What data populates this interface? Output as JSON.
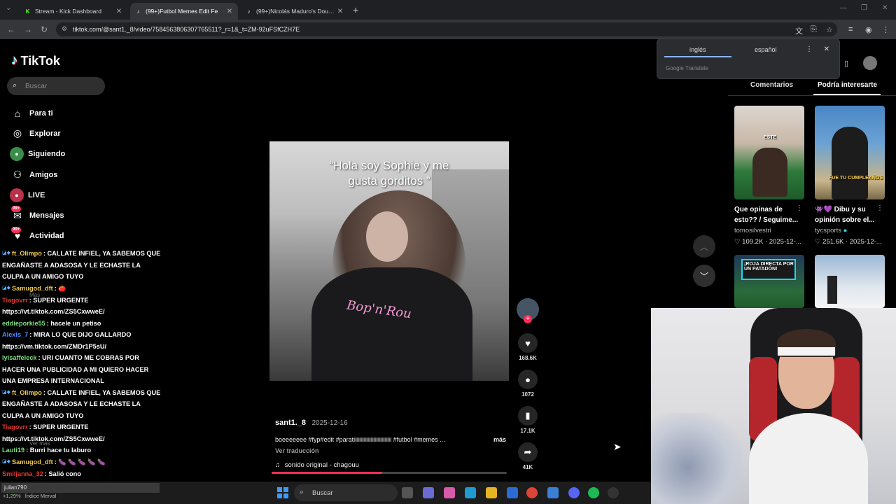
{
  "browser": {
    "tabs": [
      {
        "title": "Stream - Kick Dashboard",
        "favicon": "K",
        "color": "#53fc18",
        "active": false
      },
      {
        "title": "(99+)Futbol Memes Edit Fe",
        "favicon": "♪",
        "color": "#ffffff",
        "active": true
      },
      {
        "title": "(99+)Nicolás Maduro's Doubts",
        "favicon": "♪",
        "color": "#ffffff",
        "active": false
      }
    ],
    "url": "tiktok.com/@sant1._8/video/7584563806307765511?_r=1&_t=ZM-92uFSfCZH7E"
  },
  "translate_popup": {
    "source_lang": "inglés",
    "target_lang": "español",
    "provider": "Google Translate"
  },
  "sidebar": {
    "logo": "TikTok",
    "search_placeholder": "Buscar",
    "items": [
      {
        "label": "Para ti",
        "icon": "home-icon",
        "glyph": "⌂"
      },
      {
        "label": "Explorar",
        "icon": "compass-icon",
        "glyph": "◎"
      },
      {
        "label": "Siguiendo",
        "icon": "following-avatar-icon",
        "glyph": "●"
      },
      {
        "label": "Amigos",
        "icon": "friends-icon",
        "glyph": "⚇"
      },
      {
        "label": "LIVE",
        "icon": "live-icon",
        "glyph": "●"
      },
      {
        "label": "Mensajes",
        "icon": "messages-icon",
        "glyph": "✉",
        "badge": "99+"
      },
      {
        "label": "Actividad",
        "icon": "activity-icon",
        "glyph": "♥",
        "badge": "99+"
      }
    ]
  },
  "chat": [
    {
      "user": "ft_Olimpo",
      "color": "#f2c94c",
      "badges": "◪◆",
      "text": ": CALLATE INFIEL, YA SABEMOS QUE ENGAÑASTE A ADASOSA Y LE ECHASTE LA CULPA A UN AMIGO TUYO"
    },
    {
      "user": "Samugod_dft",
      "color": "#f2c94c",
      "badges": "◪◆",
      "text": ": 🍅"
    },
    {
      "user": "Tiagovrr",
      "color": "#e53935",
      "badges": "",
      "text": ": SUPER URGENTE https://vt.tiktok.com/ZS5CxwweE/"
    },
    {
      "user": "eddieporkie55",
      "color": "#7ee081",
      "badges": "",
      "text": ": hacele un petiso"
    },
    {
      "user": "Alexis_7",
      "color": "#4a8cff",
      "badges": "",
      "text": ": MIRA LO QUE DIJO GALLARDO https://vm.tiktok.com/ZMDr1P5sU/"
    },
    {
      "user": "lyisaffeleck",
      "color": "#7ee081",
      "badges": "",
      "text": ": URI CUANTO ME COBRAS POR HACER UNA PUBLICIDAD A MI QUIERO HACER UNA EMPRESA INTERNACIONAL"
    },
    {
      "user": "ft_Olimpo",
      "color": "#f2c94c",
      "badges": "◪◆",
      "text": ": CALLATE INFIEL, YA SABEMOS QUE ENGAÑASTE A ADASOSA Y LE ECHASTE LA CULPA A UN AMIGO TUYO"
    },
    {
      "user": "Tiagovrr",
      "color": "#e53935",
      "badges": "",
      "text": ": SUPER URGENTE https://vt.tiktok.com/ZS5CxwweE/"
    },
    {
      "user": "Lauti19",
      "color": "#7ee081",
      "badges": "",
      "text": ": Burri hace tu laburo"
    },
    {
      "user": "Samugod_dft",
      "color": "#f2c94c",
      "badges": "◪◆",
      "text": ": 🍆 🍆 🍆 🍆 🍆"
    },
    {
      "user": "Smiljanna_32",
      "color": "#e53935",
      "badges": "",
      "text": ": Salió cono"
    }
  ],
  "video": {
    "caption_line1": "“Hola soy Sophie y me",
    "caption_line2": "gusta gorditos ”",
    "jersey_text": "Bop'n'Rou",
    "author": "sant1._8",
    "date": "2025-12-16",
    "description": "boeeeeeee #fyp#edit #paratiiiiiiiiiiiiiiiiiiiiiiiiiii #futbol #memes ...",
    "more_label": "más",
    "translate_label": "Ver traducción",
    "sound": "sonido original - chagouu",
    "progress": 0.47
  },
  "actions": {
    "likes": "168.6K",
    "comments": "1072",
    "saves": "17.1K",
    "shares": "41K"
  },
  "right_panel": {
    "tabs": [
      "Comentarios",
      "Podría interesarte"
    ],
    "active_tab": 1,
    "cards": [
      {
        "title": "Que opinas de esto?? / Seguime...",
        "author": "tomosilvestri",
        "views": "109.2K",
        "date": "2025-12-...",
        "thumb_label": "ESTE",
        "verified": false
      },
      {
        "title": "👾💜 Dibu y su opinión sobre el...",
        "author": "tycsports",
        "views": "251.6K",
        "date": "2025-12-...",
        "thumb_label": "FUE TU CUMPLEAÑOS",
        "verified": true
      },
      {
        "title": "",
        "author": "",
        "views": "",
        "date": "",
        "thumb_label": "¡ROJA DIRECTA POR UN PATADÓN!",
        "verified": false
      },
      {
        "title": "",
        "author": "",
        "views": "",
        "date": "",
        "thumb_label": "",
        "verified": false
      }
    ]
  },
  "taskbar": {
    "search_placeholder": "Buscar",
    "weather_user": "julian790",
    "stock_label": "Índice Merval",
    "stock_change": "+1,29%"
  }
}
